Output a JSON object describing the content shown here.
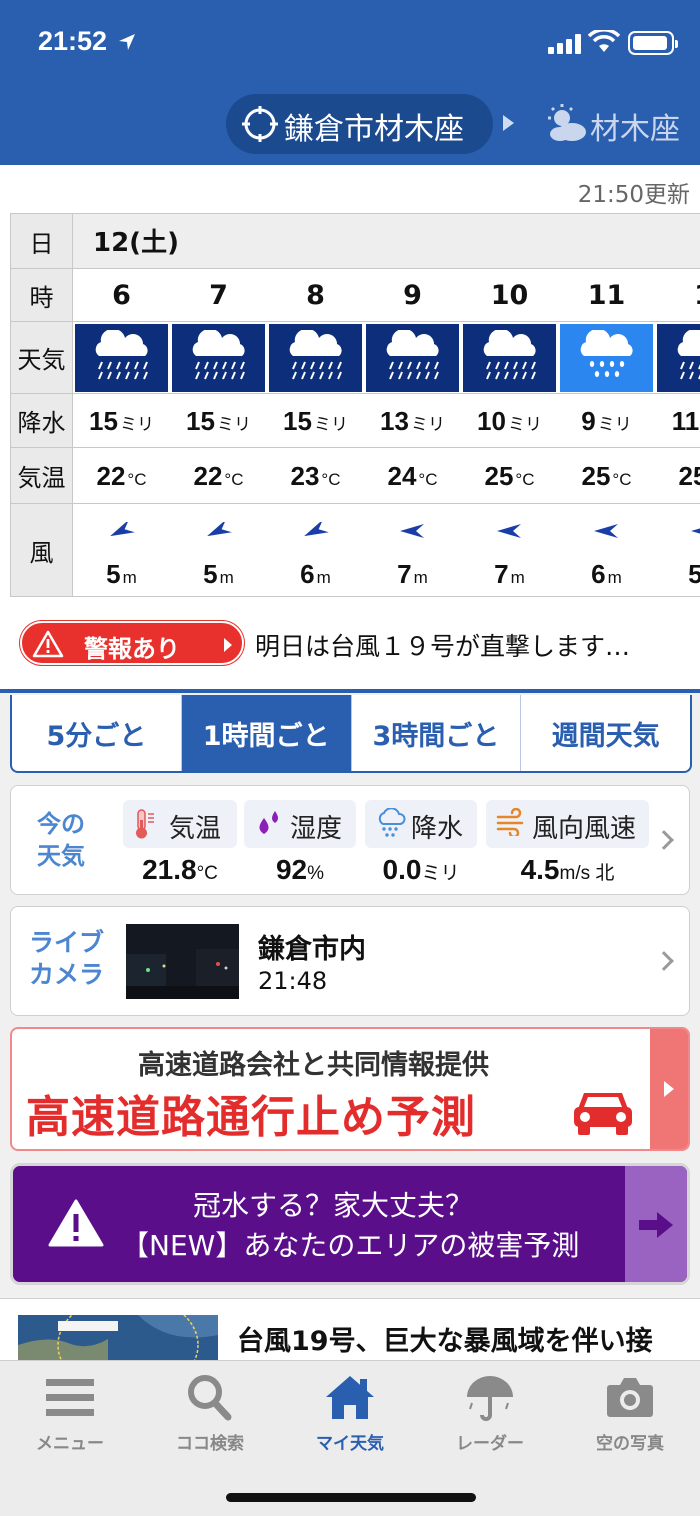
{
  "status_bar": {
    "time": "21:52"
  },
  "header": {
    "location": "鎌倉市材木座",
    "next_location": "材木座"
  },
  "updated": "21:50更新",
  "forecast": {
    "labels": {
      "day": "日",
      "hour": "時",
      "weather": "天気",
      "precip": "降水",
      "temp": "気温",
      "wind": "風"
    },
    "day": "12(土)",
    "hours": [
      "6",
      "7",
      "8",
      "9",
      "10",
      "11",
      "1"
    ],
    "weather": [
      "rain-heavy",
      "rain-heavy",
      "rain-heavy",
      "rain-heavy",
      "rain-heavy",
      "rain",
      "rain-heavy"
    ],
    "precip": [
      "15",
      "15",
      "15",
      "13",
      "10",
      "9",
      "11"
    ],
    "precip_unit": "ミリ",
    "temp": [
      "22",
      "22",
      "23",
      "24",
      "25",
      "25",
      "25"
    ],
    "temp_unit": "°C",
    "wind_speed": [
      "5",
      "5",
      "6",
      "7",
      "7",
      "6",
      "5"
    ],
    "wind_unit": "m",
    "wind_direction": [
      "north-east",
      "north-east",
      "north-east",
      "east",
      "east",
      "east",
      "east"
    ]
  },
  "alert": {
    "label": "警報あり",
    "message": "明日は台風１９号が直撃します…"
  },
  "tabs": [
    {
      "label": "5分ごと",
      "active": false
    },
    {
      "label": "1時間ごと",
      "active": true
    },
    {
      "label": "3時間ごと",
      "active": false
    },
    {
      "label": "週間天気",
      "active": false
    }
  ],
  "current": {
    "title_line1": "今の",
    "title_line2": "天気",
    "temp_label": "気温",
    "temp_value": "21.8",
    "temp_unit": "°C",
    "humidity_label": "湿度",
    "humidity_value": "92",
    "humidity_unit": "%",
    "precip_label": "降水",
    "precip_value": "0.0",
    "precip_unit": "ミリ",
    "wind_label": "風向風速",
    "wind_value": "4.5",
    "wind_unit": "m/s 北"
  },
  "camera": {
    "title_line1": "ライブ",
    "title_line2": "カメラ",
    "name": "鎌倉市内",
    "time": "21:48"
  },
  "banner_highway": {
    "sub": "高速道路会社と共同情報提供",
    "main": "高速道路通行止め予測"
  },
  "banner_flood": {
    "line1": "冠水する？家大丈夫？",
    "line2": "【NEW】あなたのエリアの被害予測"
  },
  "news": {
    "title": "台風19号、巨大な暴風域を伴い接"
  },
  "bottom_nav": [
    {
      "label": "メニュー",
      "icon": "menu-icon",
      "active": false
    },
    {
      "label": "ココ検索",
      "icon": "search-icon",
      "active": false
    },
    {
      "label": "マイ天気",
      "icon": "home-icon",
      "active": true
    },
    {
      "label": "レーダー",
      "icon": "umbrella-icon",
      "active": false
    },
    {
      "label": "空の写真",
      "icon": "camera-icon",
      "active": false
    }
  ],
  "colors": {
    "brand": "#2a5fb0",
    "alert": "#e8312c",
    "rain_dark": "#0d2e7a",
    "rain_light": "#2b86f0",
    "flood_banner": "#5a0e8a"
  }
}
